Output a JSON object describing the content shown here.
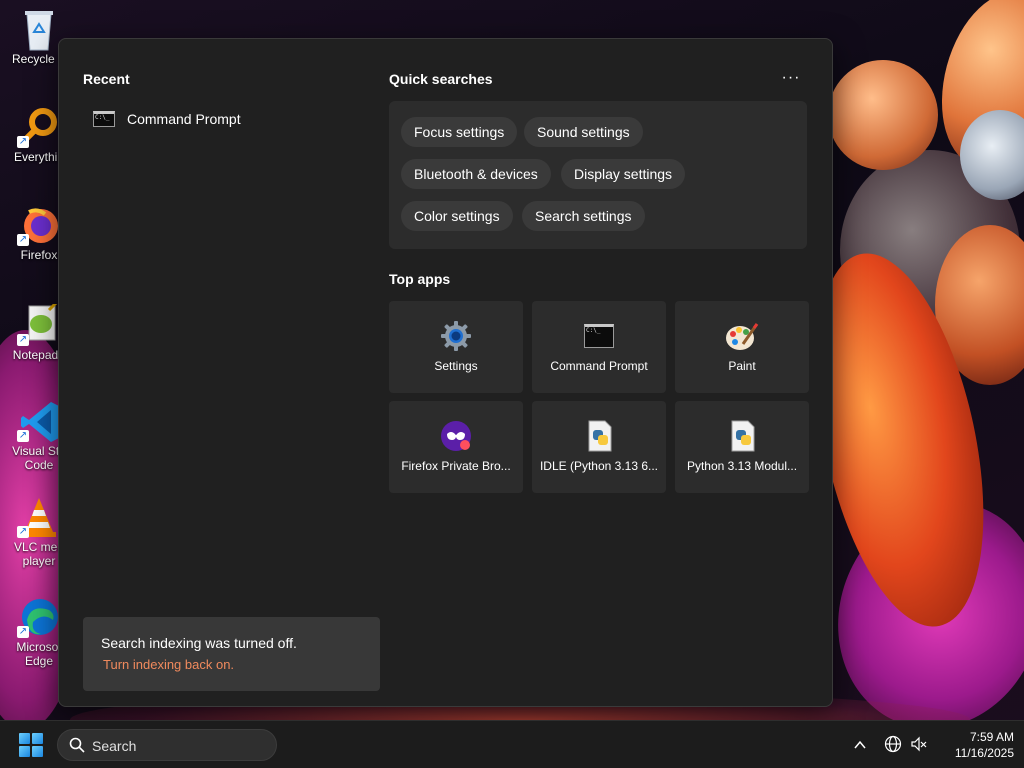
{
  "desktop": {
    "icons": [
      {
        "label": "Recycle Bin",
        "display": "Recycle B"
      },
      {
        "label": "Everything",
        "display": "Everythin"
      },
      {
        "label": "Firefox",
        "display": "Firefox"
      },
      {
        "label": "Notepad++",
        "display": "Notepad+"
      },
      {
        "label": "Visual Studio Code",
        "display": "Visual Stu Code"
      },
      {
        "label": "VLC media player",
        "display": "VLC med player"
      },
      {
        "label": "Microsoft Edge",
        "display": "Microsof Edge"
      }
    ]
  },
  "start_panel": {
    "recent": {
      "title": "Recent",
      "items": [
        {
          "label": "Command Prompt",
          "icon": "command-prompt-icon"
        }
      ]
    },
    "quick_searches": {
      "title": "Quick searches",
      "more_label": "···",
      "chips": [
        "Focus settings",
        "Sound settings",
        "Bluetooth & devices",
        "Display settings",
        "Color settings",
        "Search settings"
      ]
    },
    "top_apps": {
      "title": "Top apps",
      "apps": [
        {
          "label": "Settings",
          "icon": "settings-gear-icon"
        },
        {
          "label": "Command Prompt",
          "icon": "command-prompt-icon"
        },
        {
          "label": "Paint",
          "icon": "paint-palette-icon"
        },
        {
          "label": "Firefox Private Bro...",
          "icon": "firefox-private-icon"
        },
        {
          "label": "IDLE (Python 3.13 6...",
          "icon": "python-file-icon"
        },
        {
          "label": "Python 3.13 Modul...",
          "icon": "python-file-icon"
        }
      ]
    },
    "notice": {
      "title": "Search indexing was turned off.",
      "link": "Turn indexing back on."
    }
  },
  "taskbar": {
    "search_placeholder": "Search",
    "clock": {
      "time": "7:59 AM",
      "date": "11/16/2025"
    }
  },
  "colors": {
    "panel_bg": "#202020",
    "tile_bg": "#2c2c2c",
    "chip_bg": "#3a3a3a",
    "link": "#f08a5d",
    "taskbar_bg": "#1c1c1c"
  }
}
